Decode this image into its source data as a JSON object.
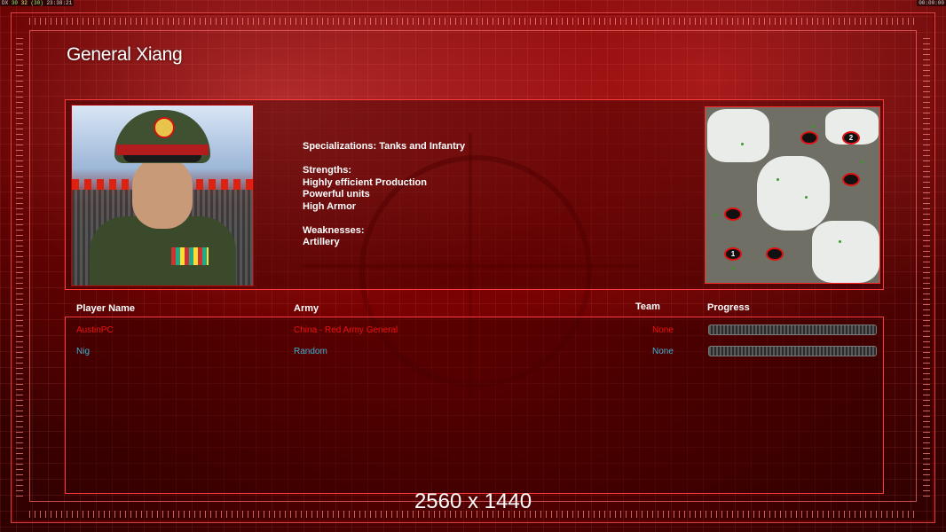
{
  "hud": {
    "left_segments": [
      "DX",
      "30",
      "32",
      "(30)"
    ],
    "clock_left": "23:38:21",
    "clock_right": "00:00:00"
  },
  "general": {
    "title": "General Xiang",
    "specializations": "Specializations: Tanks and Infantry",
    "strengths_heading": "Strengths:",
    "strengths": [
      "Highly efficient Production",
      "Powerful units",
      "High Armor"
    ],
    "weaknesses_heading": "Weaknesses:",
    "weaknesses": [
      "Artillery"
    ]
  },
  "minimap": {
    "start_positions": [
      "",
      "2",
      "",
      "",
      "1",
      ""
    ]
  },
  "players_table": {
    "headers": {
      "name": "Player Name",
      "army": "Army",
      "team": "Team",
      "progress": "Progress"
    },
    "rows": [
      {
        "name": "AustinPC",
        "army": "China - Red Army General",
        "team": "None",
        "progress": 1.0,
        "color": "#e11111"
      },
      {
        "name": "Nig",
        "army": "Random",
        "team": "None",
        "progress": 1.0,
        "color": "#3fb0d0"
      }
    ]
  },
  "resolution_label": "2560 x 1440",
  "colors": {
    "accent_red": "#ff3a3a",
    "player1": "#e11111",
    "player2": "#3fb0d0"
  }
}
